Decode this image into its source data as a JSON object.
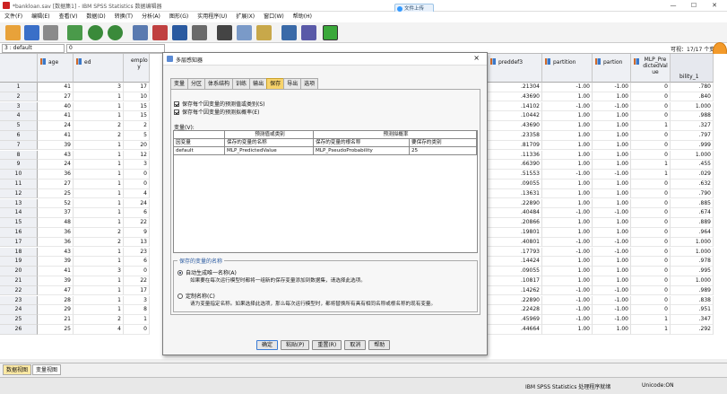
{
  "window": {
    "title": "*bankloan.sav [数据集1] - IBM SPSS Statistics 数据编辑器",
    "badge": "文件上传"
  },
  "menus": [
    "文件(F)",
    "编辑(E)",
    "查看(V)",
    "数据(D)",
    "转换(T)",
    "分析(A)",
    "图形(G)",
    "实用程序(U)",
    "扩展(X)",
    "窗口(W)",
    "帮助(H)"
  ],
  "refbar": {
    "cell_ref": "3 : default",
    "cell_value": "0",
    "visible": "可视：17/17 个变"
  },
  "columns": [
    "age",
    "ed",
    "emplo y",
    "preddef3",
    "partition",
    "partion",
    "MLP_Pre dictedVal ue",
    "bility_1"
  ],
  "rows": [
    {
      "n": "1",
      "age": "41",
      "ed": "3",
      "emp": "17",
      "pd": ".21304",
      "pt": "-1.00",
      "pa": "-1.00",
      "mp": "0",
      "pb": ".780"
    },
    {
      "n": "2",
      "age": "27",
      "ed": "1",
      "emp": "10",
      "pd": ".43690",
      "pt": "1.00",
      "pa": "1.00",
      "mp": "0",
      "pb": ".840"
    },
    {
      "n": "3",
      "age": "40",
      "ed": "1",
      "emp": "15",
      "pd": ".14102",
      "pt": "-1.00",
      "pa": "-1.00",
      "mp": "0",
      "pb": "1.000"
    },
    {
      "n": "4",
      "age": "41",
      "ed": "1",
      "emp": "15",
      "pd": ".10442",
      "pt": "1.00",
      "pa": "1.00",
      "mp": "0",
      "pb": ".988"
    },
    {
      "n": "5",
      "age": "24",
      "ed": "2",
      "emp": "2",
      "pd": ".43690",
      "pt": "1.00",
      "pa": "1.00",
      "mp": "1",
      "pb": ".327"
    },
    {
      "n": "6",
      "age": "41",
      "ed": "2",
      "emp": "5",
      "pd": ".23358",
      "pt": "1.00",
      "pa": "1.00",
      "mp": "0",
      "pb": ".797"
    },
    {
      "n": "7",
      "age": "39",
      "ed": "1",
      "emp": "20",
      "pd": ".81709",
      "pt": "1.00",
      "pa": "1.00",
      "mp": "0",
      "pb": ".999"
    },
    {
      "n": "8",
      "age": "43",
      "ed": "1",
      "emp": "12",
      "pd": ".11336",
      "pt": "1.00",
      "pa": "1.00",
      "mp": "0",
      "pb": "1.000"
    },
    {
      "n": "9",
      "age": "24",
      "ed": "1",
      "emp": "3",
      "pd": ".66390",
      "pt": "1.00",
      "pa": "1.00",
      "mp": "1",
      "pb": ".455"
    },
    {
      "n": "10",
      "age": "36",
      "ed": "1",
      "emp": "0",
      "pd": ".51553",
      "pt": "-1.00",
      "pa": "-1.00",
      "mp": "1",
      "pb": ".029"
    },
    {
      "n": "11",
      "age": "27",
      "ed": "1",
      "emp": "0",
      "pd": ".09055",
      "pt": "1.00",
      "pa": "1.00",
      "mp": "0",
      "pb": ".632"
    },
    {
      "n": "12",
      "age": "25",
      "ed": "1",
      "emp": "4",
      "pd": ".13631",
      "pt": "1.00",
      "pa": "1.00",
      "mp": "0",
      "pb": ".790"
    },
    {
      "n": "13",
      "age": "52",
      "ed": "1",
      "emp": "24",
      "pd": ".22890",
      "pt": "1.00",
      "pa": "1.00",
      "mp": "0",
      "pb": ".885"
    },
    {
      "n": "14",
      "age": "37",
      "ed": "1",
      "emp": "6",
      "pd": ".40484",
      "pt": "-1.00",
      "pa": "-1.00",
      "mp": "0",
      "pb": ".674"
    },
    {
      "n": "15",
      "age": "48",
      "ed": "1",
      "emp": "22",
      "pd": ".20866",
      "pt": "1.00",
      "pa": "1.00",
      "mp": "0",
      "pb": ".889"
    },
    {
      "n": "16",
      "age": "36",
      "ed": "2",
      "emp": "9",
      "pd": ".19801",
      "pt": "1.00",
      "pa": "1.00",
      "mp": "0",
      "pb": ".964"
    },
    {
      "n": "17",
      "age": "36",
      "ed": "2",
      "emp": "13",
      "pd": ".40801",
      "pt": "-1.00",
      "pa": "-1.00",
      "mp": "0",
      "pb": "1.000"
    },
    {
      "n": "18",
      "age": "43",
      "ed": "1",
      "emp": "23",
      "pd": ".17793",
      "pt": "-1.00",
      "pa": "-1.00",
      "mp": "0",
      "pb": "1.000"
    },
    {
      "n": "19",
      "age": "39",
      "ed": "1",
      "emp": "6",
      "pd": ".14424",
      "pt": "1.00",
      "pa": "1.00",
      "mp": "0",
      "pb": ".978"
    },
    {
      "n": "20",
      "age": "41",
      "ed": "3",
      "emp": "0",
      "pd": ".09055",
      "pt": "1.00",
      "pa": "1.00",
      "mp": "0",
      "pb": ".995"
    },
    {
      "n": "21",
      "age": "39",
      "ed": "1",
      "emp": "22",
      "pd": ".10817",
      "pt": "1.00",
      "pa": "1.00",
      "mp": "0",
      "pb": "1.000"
    },
    {
      "n": "22",
      "age": "47",
      "ed": "1",
      "emp": "17",
      "pd": ".14262",
      "pt": "-1.00",
      "pa": "-1.00",
      "mp": "0",
      "pb": ".989"
    },
    {
      "n": "23",
      "age": "28",
      "ed": "1",
      "emp": "3",
      "pd": ".22890",
      "pt": "-1.00",
      "pa": "-1.00",
      "mp": "0",
      "pb": ".838"
    },
    {
      "n": "24",
      "age": "29",
      "ed": "1",
      "emp": "8",
      "pd": ".22428",
      "pt": "-1.00",
      "pa": "-1.00",
      "mp": "0",
      "pb": ".951"
    },
    {
      "n": "25",
      "age": "21",
      "ed": "2",
      "emp": "1",
      "pd": ".45969",
      "pt": "-1.00",
      "pa": "-1.00",
      "mp": "1",
      "pb": ".347"
    },
    {
      "n": "26",
      "age": "25",
      "ed": "4",
      "emp": "0",
      "pd": ".44664",
      "pt": "1.00",
      "pa": "1.00",
      "mp": "1",
      "pb": ".292"
    }
  ],
  "dialog": {
    "title": "多层感知器",
    "tabs": [
      "变量",
      "分区",
      "体系结构",
      "训练",
      "输出",
      "保存",
      "导出",
      "选项"
    ],
    "check1": "保存每个因变量的预测值或类别(S)",
    "check2": "保存每个因变量的预测拟概率(E)",
    "table_label": "变量(V):",
    "table_header1": "预测值或类别",
    "table_header2": "预测拟概率",
    "table_cols": [
      "因变量",
      "保存的变量的名称",
      "保存的变量的根名称",
      "要保存的类别"
    ],
    "table_row": [
      "default",
      "MLP_PredictedValue",
      "MLP_PseudoProbability",
      "25"
    ],
    "group_label": "保存的变量的名称",
    "radio1": "自动生成唯一名称(A)",
    "radio1_desc": "如果要在每次运行模型时都将一组新的保存变量添加到数据集，请选择此选项。",
    "radio2": "定制名称(C)",
    "radio2_desc": "请为变量指定名称。如果选择此选项，那么每次运行模型时，都将替换所有具有相同名称或根名称的现有变量。",
    "buttons": [
      "确定",
      "粘贴(P)",
      "重置(R)",
      "取消",
      "帮助"
    ]
  },
  "bottom_tabs": [
    "数据视图",
    "变量视图"
  ],
  "status": {
    "processor": "IBM SPSS Statistics 处理程序就绪",
    "unicode": "Unicode:ON"
  }
}
